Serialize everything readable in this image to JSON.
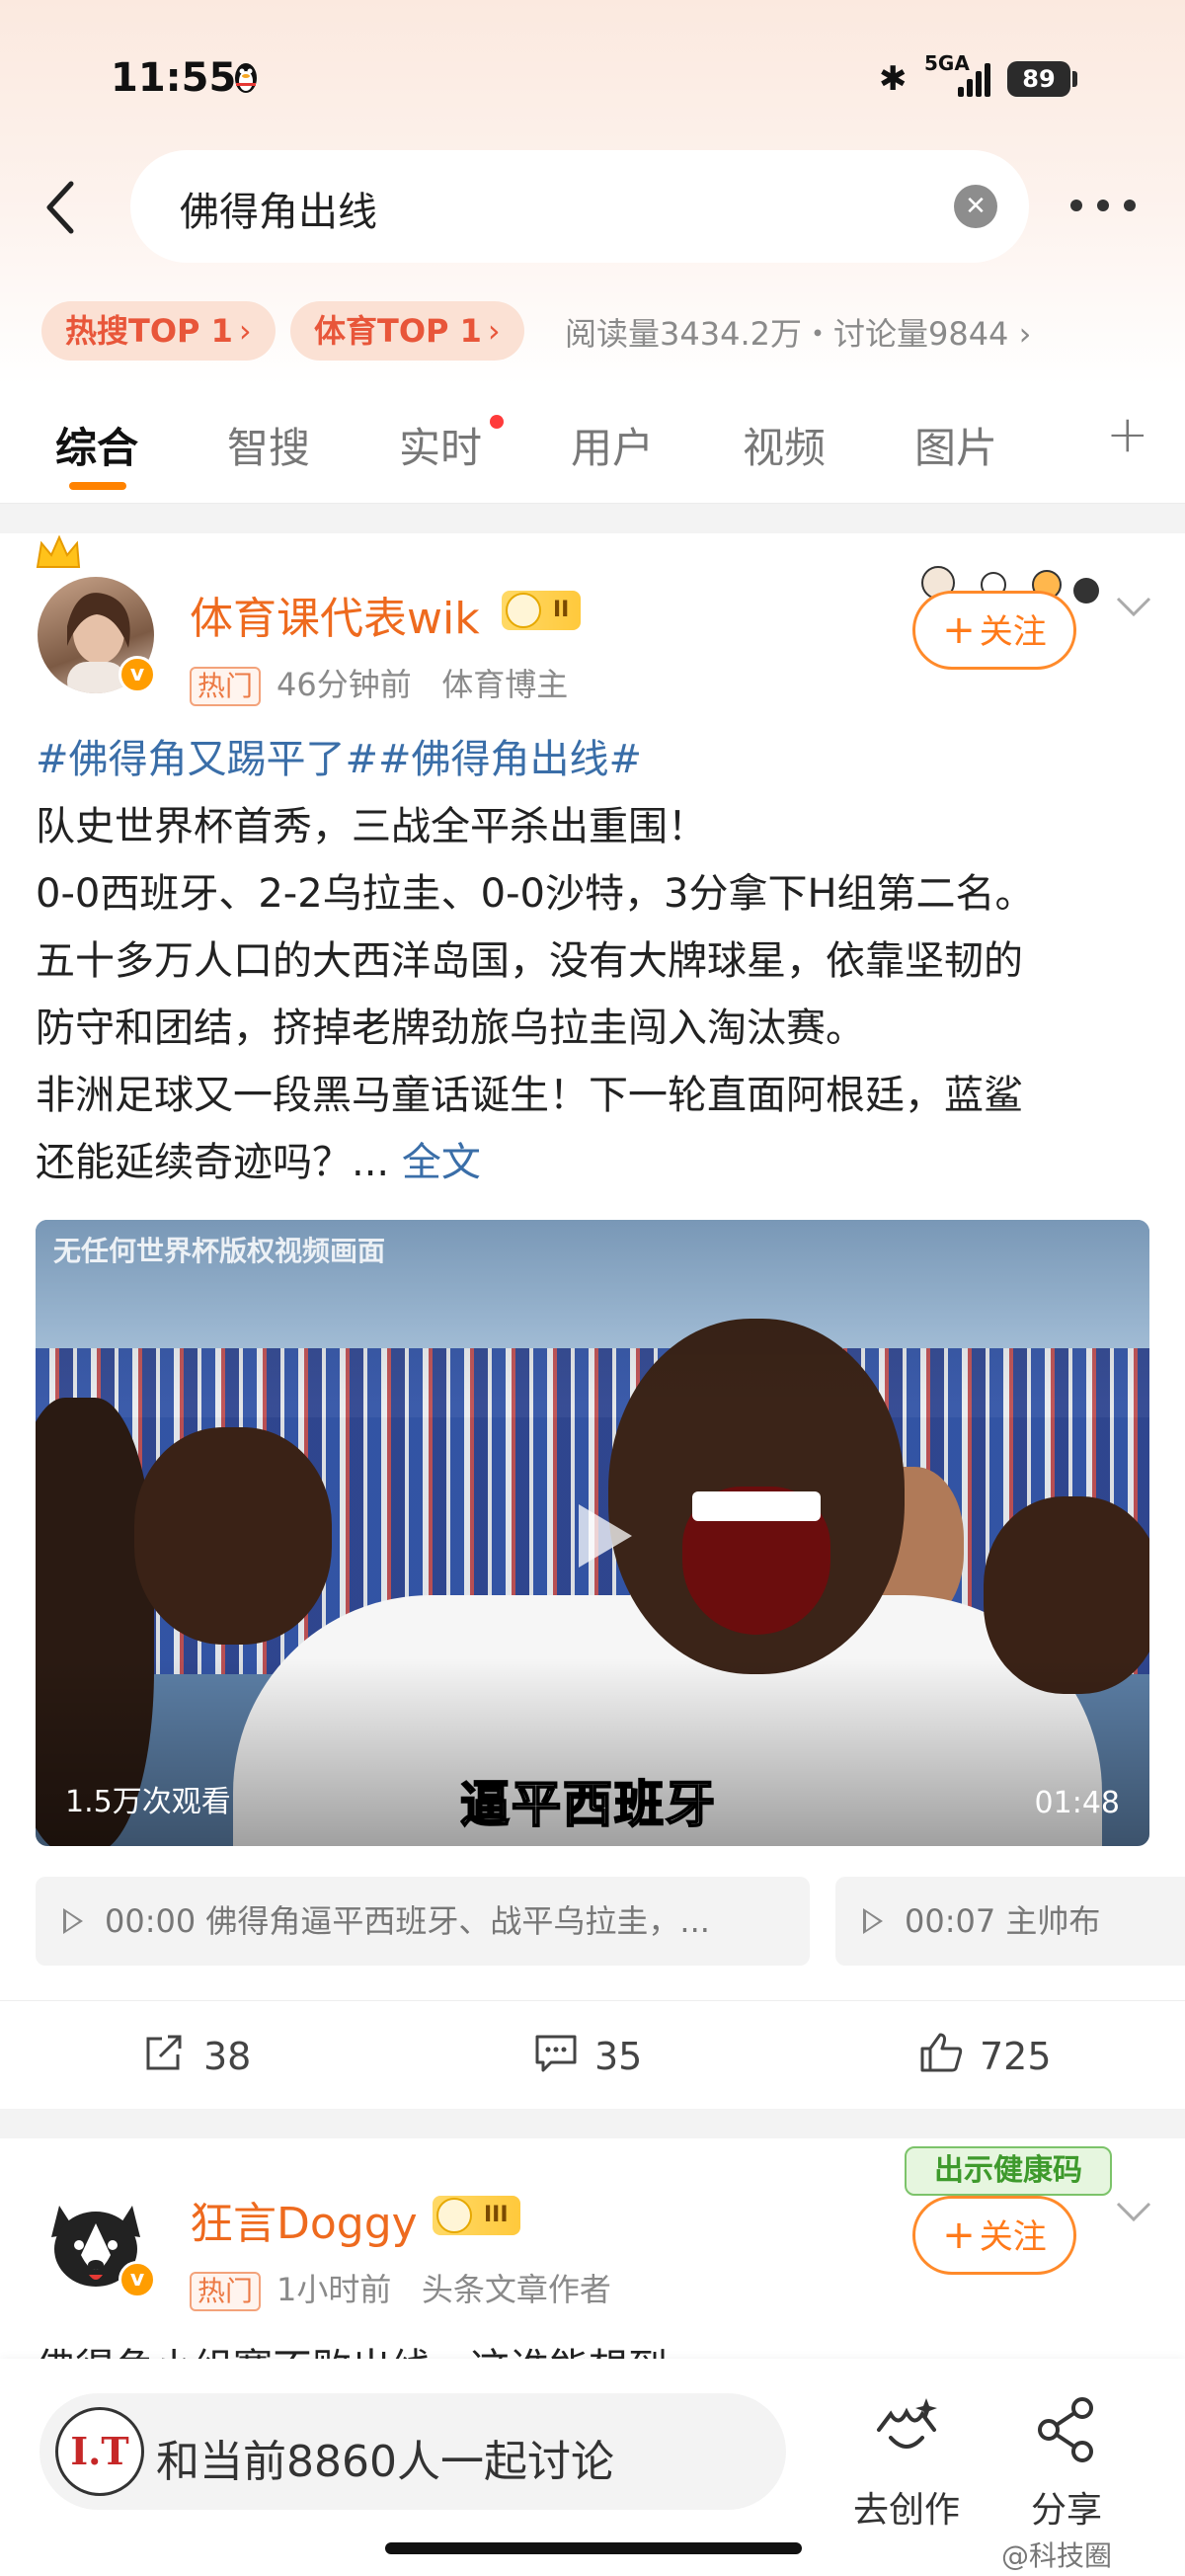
{
  "status": {
    "time": "11:55",
    "network": "5GA",
    "battery": "89"
  },
  "search": {
    "query": "佛得角出线"
  },
  "hot_tags": [
    {
      "label": "热搜TOP 1"
    },
    {
      "label": "体育TOP 1"
    }
  ],
  "stats": "阅读量3434.2万・讨论量9844",
  "tabs": [
    "综合",
    "智搜",
    "实时",
    "用户",
    "视频",
    "图片"
  ],
  "post1": {
    "author": "体育课代表wik",
    "level": "II",
    "hot_label": "热门",
    "time": "46分钟前",
    "source": "体育博主",
    "follow": "关注",
    "hashtags": "#佛得角又踢平了##佛得角出线#",
    "lines": [
      "队史世界杯首秀，三战全平杀出重围！",
      "0-0西班牙、2-2乌拉圭、0-0沙特，3分拿下H组第二名。",
      "五十多万人口的大西洋岛国，没有大牌球星，依靠坚韧的",
      "防守和团结，挤掉老牌劲旅乌拉圭闯入淘汰赛。",
      "非洲足球又一段黑马童话诞生！下一轮直面阿根廷，蓝鲨",
      "还能延续奇迹吗？..."
    ],
    "full_text": "全文",
    "video": {
      "watermark": "无任何世界杯版权视频画面",
      "views": "1.5万次观看",
      "duration": "01:48",
      "caption": "逼平西班牙"
    },
    "chapters": [
      "00:00  佛得角逼平西班牙、战平乌拉圭，...",
      "00:07  主帅布"
    ],
    "reposts": "38",
    "comments": "35",
    "likes": "725"
  },
  "post2": {
    "author": "狂言Doggy",
    "level": "III",
    "hot_label": "热门",
    "time": "1小时前",
    "source": "头条文章作者",
    "follow": "关注",
    "sticker": "出示健康码",
    "text": "佛得角小组赛不败出线，这谁能想到..."
  },
  "bottom": {
    "discuss": "和当前8860人一起讨论",
    "create": "去创作",
    "share": "分享",
    "avatar_text": "I.T"
  },
  "watermark": "@科技圈"
}
